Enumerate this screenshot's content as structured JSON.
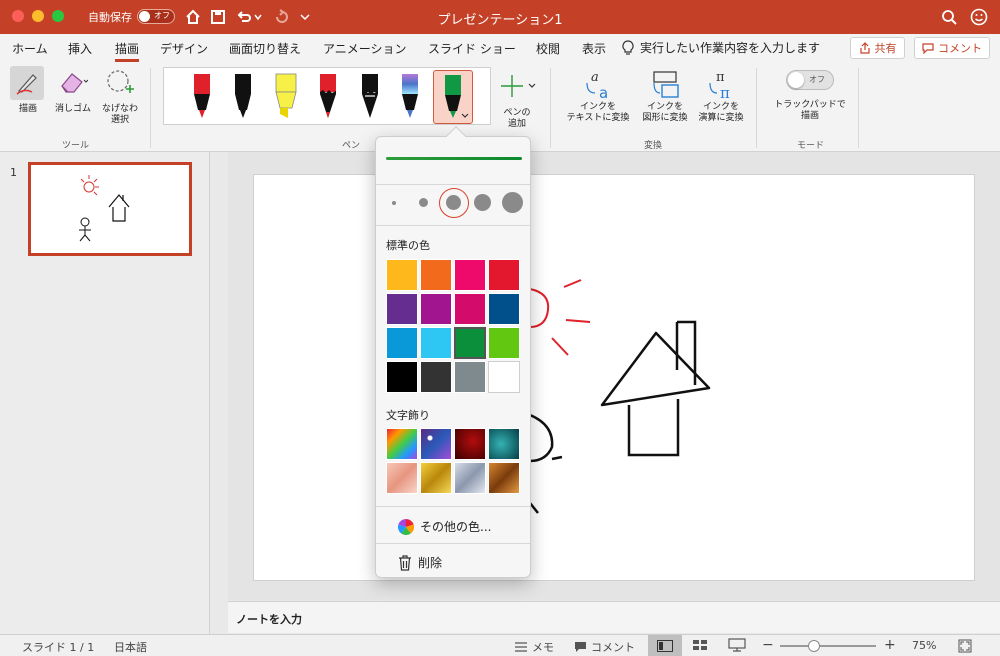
{
  "titlebar": {
    "autosave_label": "自動保存",
    "autosave_toggle": "オフ",
    "title": "プレゼンテーション1"
  },
  "tabs": [
    {
      "label": "ホーム"
    },
    {
      "label": "挿入"
    },
    {
      "label": "描画"
    },
    {
      "label": "デザイン"
    },
    {
      "label": "画面切り替え"
    },
    {
      "label": "アニメーション"
    },
    {
      "label": "スライド ショー"
    },
    {
      "label": "校閲"
    },
    {
      "label": "表示"
    }
  ],
  "tellme": "実行したい作業内容を入力します",
  "share_label": "共有",
  "comment_label": "コメント",
  "ribbon": {
    "tools": {
      "draw": "描画",
      "eraser": "消しゴム",
      "lasso_line1": "なげなわ",
      "lasso_line2": "選択",
      "group": "ツール"
    },
    "pens": {
      "add_line1": "ペンの",
      "add_line2": "追加",
      "group": "ペン"
    },
    "convert": {
      "to_text_line1": "インクを",
      "to_text_line2": "テキストに変換",
      "to_shape_line1": "インクを",
      "to_shape_line2": "図形に変換",
      "to_math_line1": "インクを",
      "to_math_line2": "演算に変換",
      "group": "変換"
    },
    "mode": {
      "toggle": "オフ",
      "label_line1": "トラックパッドで",
      "label_line2": "描画",
      "group": "モード"
    }
  },
  "pens_colors": [
    "#e0202a",
    "#000000",
    "#f7f046",
    "#e0202a",
    "#000000",
    "#4a74c9",
    "#109845"
  ],
  "thumbs": {
    "slide_number": "1"
  },
  "notes_placeholder": "ノートを入力",
  "popover": {
    "standard_colors_heading": "標準の色",
    "standard_colors": [
      "#ffb81c",
      "#f26b1d",
      "#ed0a6b",
      "#e3172e",
      "#652d90",
      "#a1168e",
      "#d30c6b",
      "#01508b",
      "#0a99d8",
      "#2ec7f4",
      "#0b8f3b",
      "#62c710",
      "#000000",
      "#333333",
      "#7f8a8f",
      "#ffffff"
    ],
    "selected_color": "#0b8f3b",
    "effects_heading": "文字飾り",
    "effects": [
      "rainbow",
      "galaxy",
      "lava",
      "ocean",
      "rose-gold",
      "gold",
      "silver",
      "bronze"
    ],
    "more_colors": "その他の色...",
    "delete": "削除"
  },
  "status": {
    "slide": "スライド 1 / 1",
    "language": "日本語",
    "notes": "メモ",
    "comments": "コメント",
    "zoom": "75%",
    "zoom_fraction": 0.35
  }
}
